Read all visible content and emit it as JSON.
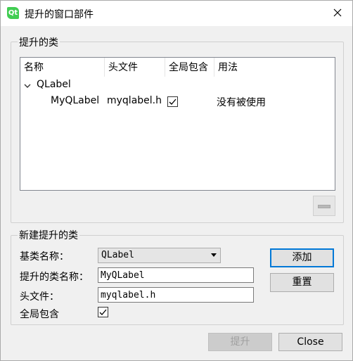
{
  "window": {
    "title": "提升的窗口部件",
    "app_icon_text": "Qt"
  },
  "promoted_classes": {
    "group_label": "提升的类",
    "columns": [
      "名称",
      "头文件",
      "全局包含",
      "用法"
    ],
    "tree": {
      "parent": "QLabel",
      "child": {
        "name": "MyQLabel",
        "header": "myqlabel.h",
        "global_include": true,
        "usage": "没有被使用"
      }
    }
  },
  "new_promoted": {
    "group_label": "新建提升的类",
    "base_class_label": "基类名称：",
    "base_class_value": "QLabel",
    "class_name_label": "提升的类名称：",
    "class_name_value": "MyQLabel",
    "header_label": "头文件：",
    "header_value": "myqlabel.h",
    "global_include_label": "全局包含",
    "global_include_checked": true,
    "add_button": "添加",
    "reset_button": "重置"
  },
  "footer": {
    "promote_button": "提升",
    "close_button": "Close"
  }
}
